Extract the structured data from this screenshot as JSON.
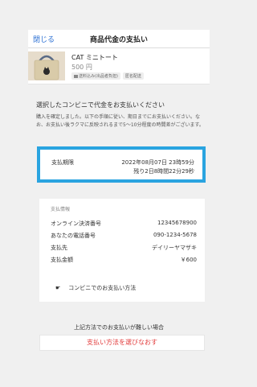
{
  "header": {
    "close_label": "閉じる",
    "title": "商品代金の支払い"
  },
  "item": {
    "name": "CAT ミニトート",
    "price": "500 円",
    "tags": [
      {
        "icon": "truck-icon",
        "label": "送料込み(出品者負担)"
      },
      {
        "label": "匿名配送"
      }
    ]
  },
  "message": {
    "heading": "選択したコンビニで代金をお支払いください",
    "body": "購入を確定しました。以下の手順に従い、期日までにお支払いください。なお、お支払い後ラクマに反映されるまで5〜10分程度の時間差がございます。"
  },
  "deadline": {
    "label": "支払期限",
    "date": "2022年08月07日 23時59分",
    "remaining": "残り2日8時間22分29秒"
  },
  "payment_info": {
    "title": "支払情報",
    "rows": [
      {
        "key": "オンライン決済番号",
        "value": "12345678900"
      },
      {
        "key": "あなたの電話番号",
        "value": "090-1234-5678"
      },
      {
        "key": "支払先",
        "value": "デイリーヤマザキ"
      },
      {
        "key": "支払金額",
        "value": "￥600"
      }
    ],
    "howto_label": "コンビニでのお支払い方法",
    "howto_icon": "hand-pointer-icon"
  },
  "alternative": {
    "heading": "上記方法でのお支払いが難しい場合",
    "button_label": "支払い方法を選びなおす"
  },
  "colors": {
    "accent": "#2a6fd3",
    "highlight_border": "#2aa4e0",
    "danger": "#e23b3b"
  }
}
